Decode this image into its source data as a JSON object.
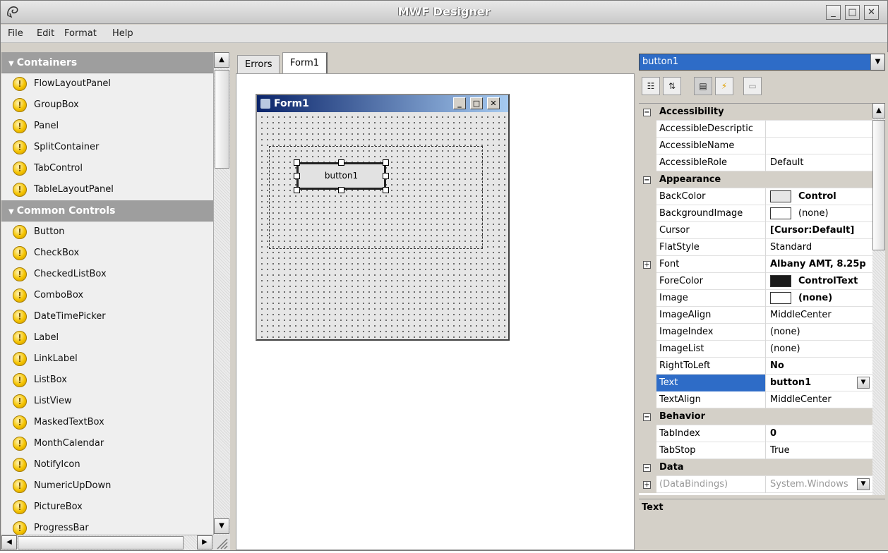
{
  "window": {
    "title": "MWF Designer",
    "min_label": "_",
    "max_label": "□",
    "close_label": "✕"
  },
  "menu": [
    "File",
    "Edit",
    "Format",
    "Help"
  ],
  "toolbox": {
    "groups": [
      {
        "label": "Containers",
        "items": [
          "FlowLayoutPanel",
          "GroupBox",
          "Panel",
          "SplitContainer",
          "TabControl",
          "TableLayoutPanel"
        ]
      },
      {
        "label": "Common Controls",
        "items": [
          "Button",
          "CheckBox",
          "CheckedListBox",
          "ComboBox",
          "DateTimePicker",
          "Label",
          "LinkLabel",
          "ListBox",
          "ListView",
          "MaskedTextBox",
          "MonthCalendar",
          "NotifyIcon",
          "NumericUpDown",
          "PictureBox",
          "ProgressBar"
        ]
      }
    ]
  },
  "designer": {
    "tabs": [
      "Errors",
      "Form1"
    ],
    "active_tab": "Form1",
    "form_title": "Form1",
    "button_text": "button1"
  },
  "properties": {
    "object_selector": "button1",
    "rows": [
      {
        "kind": "cat",
        "name": "Accessibility"
      },
      {
        "name": "AccessibleDescriptic",
        "value": ""
      },
      {
        "name": "AccessibleName",
        "value": ""
      },
      {
        "name": "AccessibleRole",
        "value": "Default"
      },
      {
        "kind": "cat",
        "name": "Appearance"
      },
      {
        "name": "BackColor",
        "value": "Control",
        "swatch": "#e6e6e6",
        "bold": true
      },
      {
        "name": "BackgroundImage",
        "value": "(none)",
        "swatch": "#ffffff"
      },
      {
        "name": "Cursor",
        "value": "[Cursor:Default]",
        "bold": true
      },
      {
        "name": "FlatStyle",
        "value": "Standard"
      },
      {
        "name": "Font",
        "value": "Albany AMT, 8.25p",
        "bold": true,
        "expand": true
      },
      {
        "name": "ForeColor",
        "value": "ControlText",
        "swatch": "#1a1a1a",
        "bold": true
      },
      {
        "name": "Image",
        "value": "(none)",
        "swatch": "#ffffff",
        "bold": true
      },
      {
        "name": "ImageAlign",
        "value": "MiddleCenter"
      },
      {
        "name": "ImageIndex",
        "value": "(none)"
      },
      {
        "name": "ImageList",
        "value": "(none)"
      },
      {
        "name": "RightToLeft",
        "value": "No",
        "bold": true
      },
      {
        "name": "Text",
        "value": "button1",
        "bold": true,
        "selected": true,
        "dropdown": true
      },
      {
        "name": "TextAlign",
        "value": "MiddleCenter"
      },
      {
        "kind": "cat",
        "name": "Behavior"
      },
      {
        "name": "TabIndex",
        "value": "0",
        "bold": true
      },
      {
        "name": "TabStop",
        "value": "True"
      },
      {
        "kind": "cat",
        "name": "Data"
      },
      {
        "name": "(DataBindings)",
        "value": "System.Windows",
        "gray": true,
        "expand": true,
        "dropdown": true
      }
    ],
    "description_title": "Text"
  }
}
